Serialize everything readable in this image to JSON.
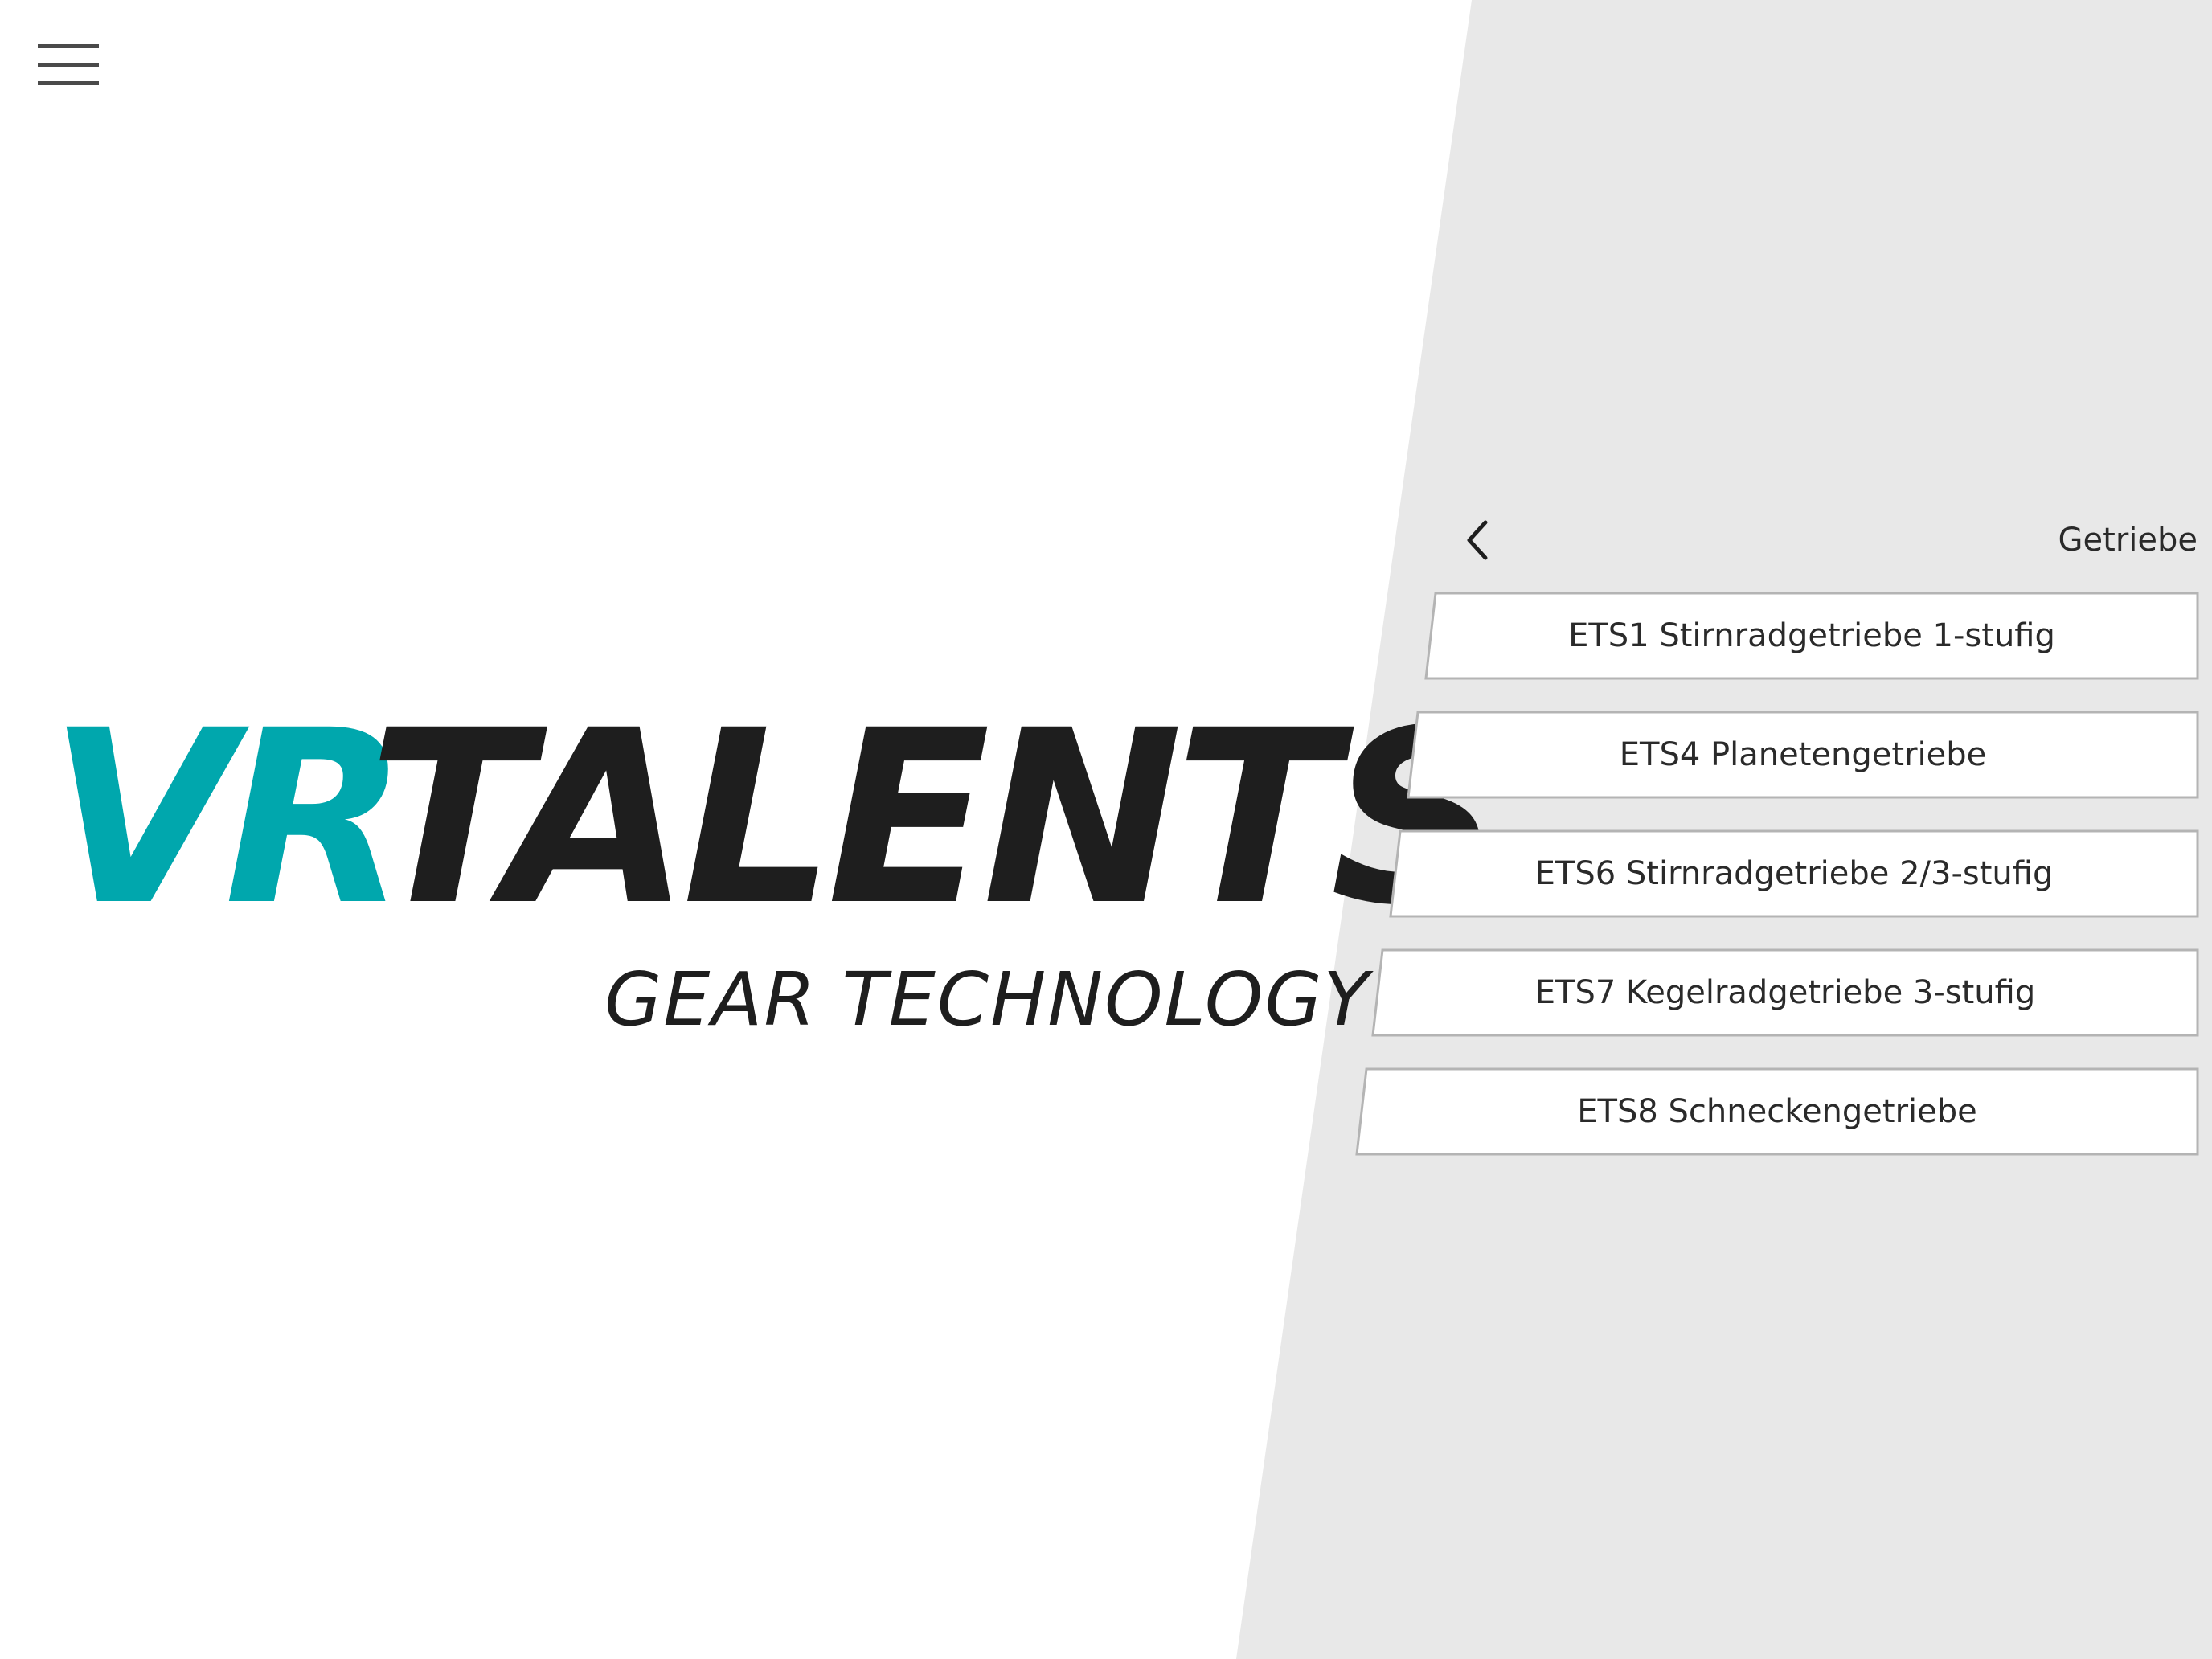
{
  "colors": {
    "brand_teal": "#00a7ad",
    "brand_dark": "#1e1e1e",
    "panel_grey": "#e8e8e8",
    "item_border": "#b4b4b4"
  },
  "menu": {
    "icon": "hamburger-menu-icon"
  },
  "logo": {
    "vr": "VR",
    "talents": "TALENTS",
    "subtitle": "GEAR TECHNOLOGY"
  },
  "panel": {
    "back_icon": "chevron-left-icon",
    "title": "Getriebe",
    "items": [
      {
        "label": "ETS1 Stirnradgetriebe 1-stufig"
      },
      {
        "label": "ETS4 Planetengetriebe"
      },
      {
        "label": "ETS6 Stirnradgetriebe 2/3-stufig"
      },
      {
        "label": "ETS7 Kegelradgetriebe 3-stufig"
      },
      {
        "label": "ETS8 Schneckengetriebe"
      }
    ]
  }
}
